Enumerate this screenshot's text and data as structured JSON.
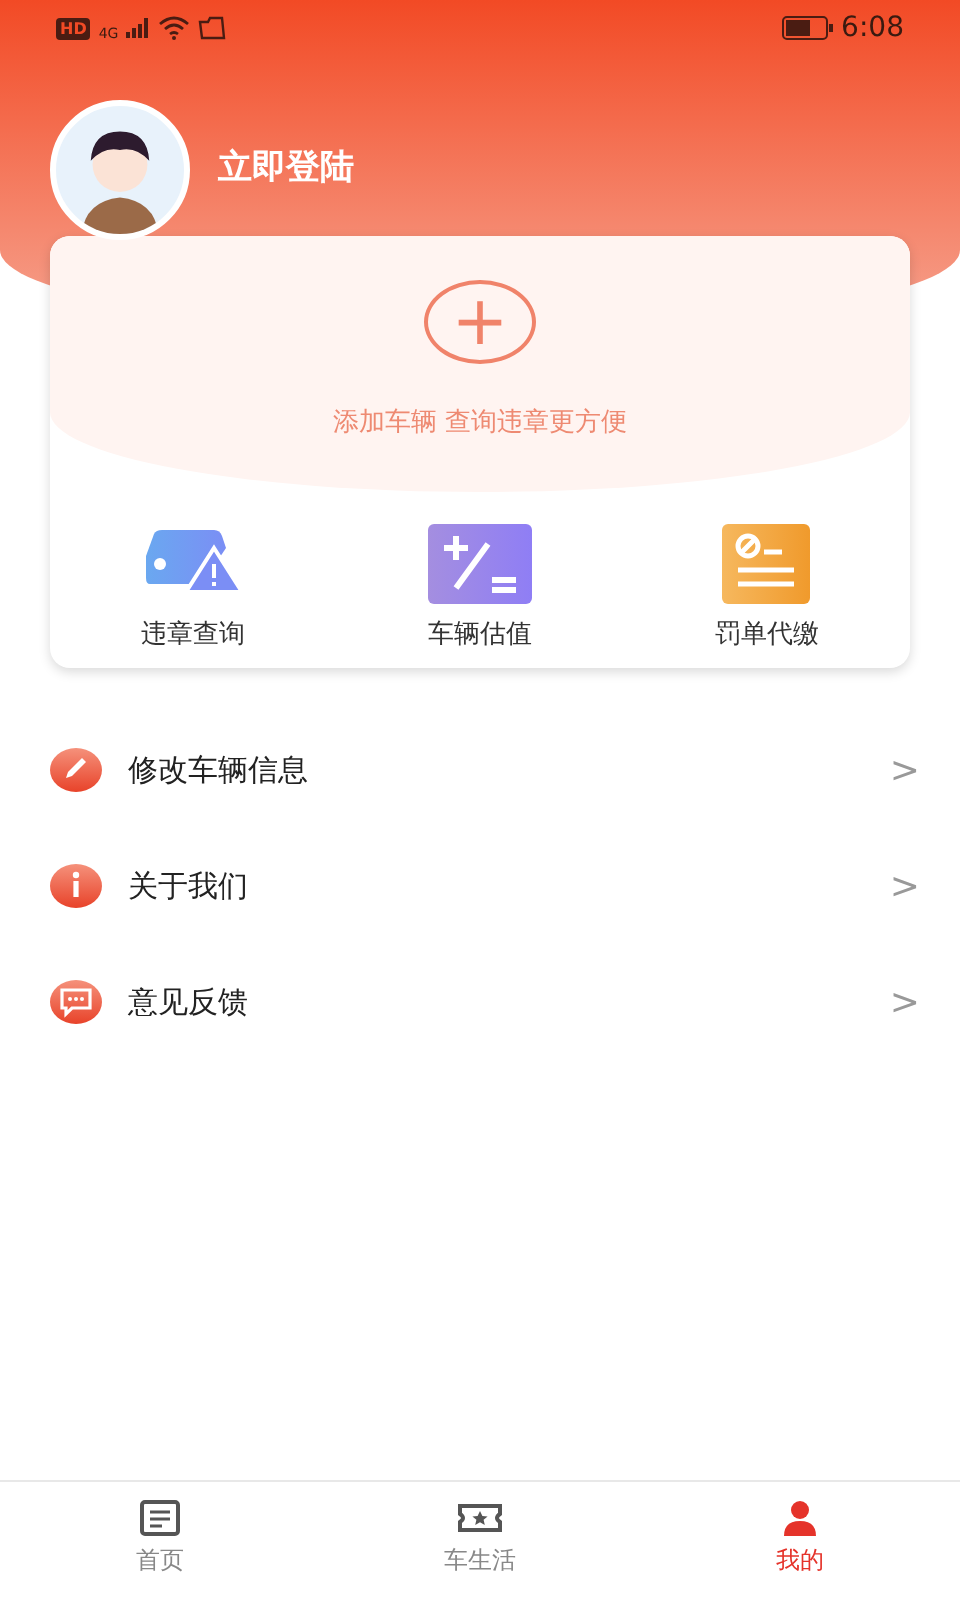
{
  "status_bar": {
    "network_badge": "HD",
    "network_type": "4G",
    "time": "6:08"
  },
  "profile": {
    "login_label": "立即登陆"
  },
  "add_vehicle": {
    "button": "+",
    "hint": "添加车辆 查询违章更方便"
  },
  "services": [
    {
      "kind": "violation",
      "label": "违章查询"
    },
    {
      "kind": "valuation",
      "label": "车辆估值"
    },
    {
      "kind": "fine",
      "label": "罚单代缴"
    }
  ],
  "menu": [
    {
      "kind": "edit",
      "label": "修改车辆信息",
      "chevron": ">"
    },
    {
      "kind": "about",
      "label": "关于我们",
      "chevron": ">"
    },
    {
      "kind": "feedback",
      "label": "意见反馈",
      "chevron": ">"
    }
  ],
  "tabs": [
    {
      "kind": "home",
      "label": "首页",
      "selected": false
    },
    {
      "kind": "life",
      "label": "车生活",
      "selected": false
    },
    {
      "kind": "mine",
      "label": "我的",
      "selected": true
    }
  ]
}
